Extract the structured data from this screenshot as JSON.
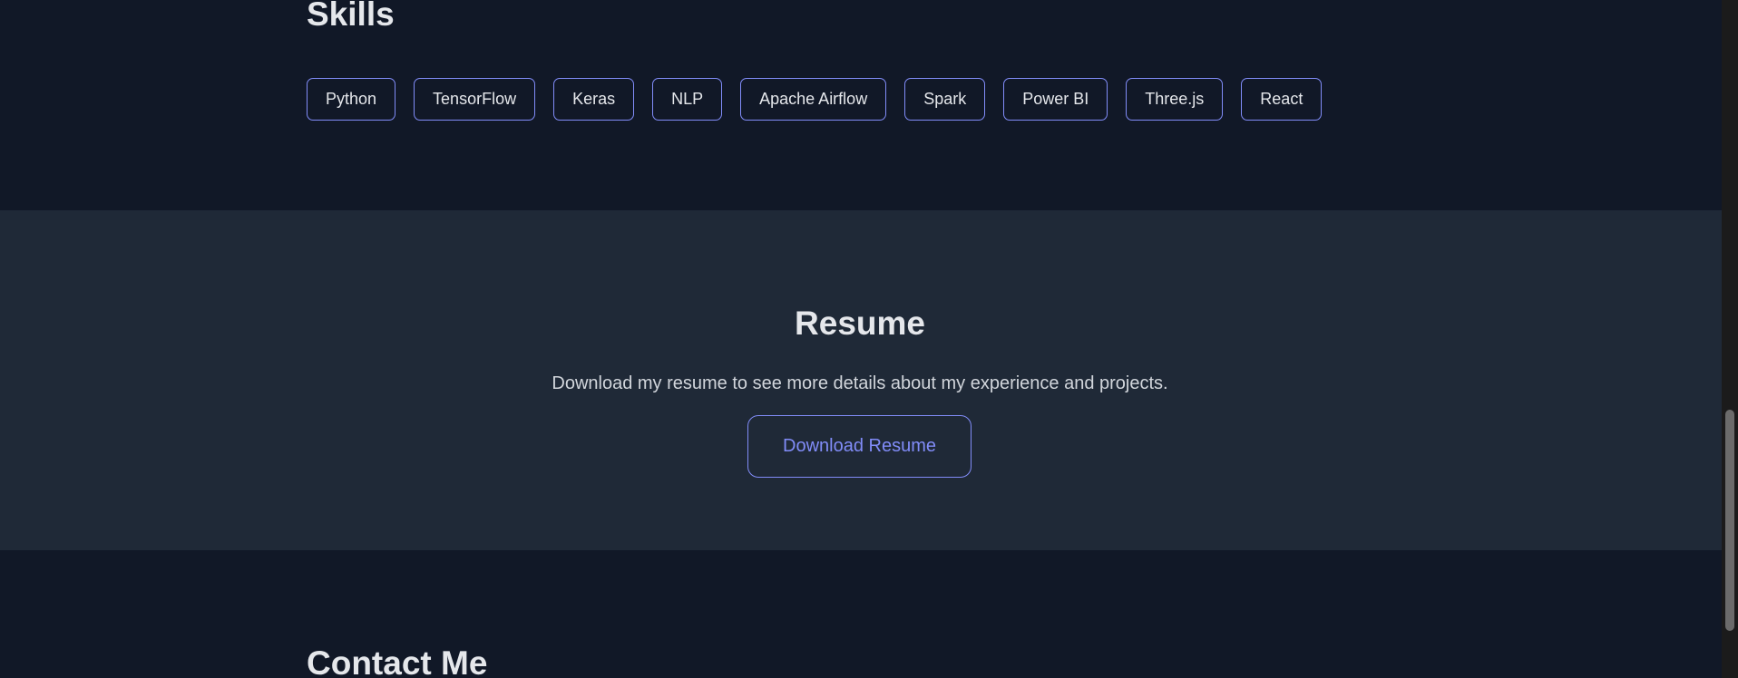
{
  "skills": {
    "title": "Skills",
    "items": [
      "Python",
      "TensorFlow",
      "Keras",
      "NLP",
      "Apache Airflow",
      "Spark",
      "Power BI",
      "Three.js",
      "React"
    ]
  },
  "resume": {
    "title": "Resume",
    "description": "Download my resume to see more details about my experience and projects.",
    "button_label": "Download Resume"
  },
  "contact": {
    "title": "Contact Me"
  },
  "colors": {
    "background": "#111827",
    "section_alt": "#1f2937",
    "accent": "#818cf8",
    "text": "#e5e7eb"
  }
}
